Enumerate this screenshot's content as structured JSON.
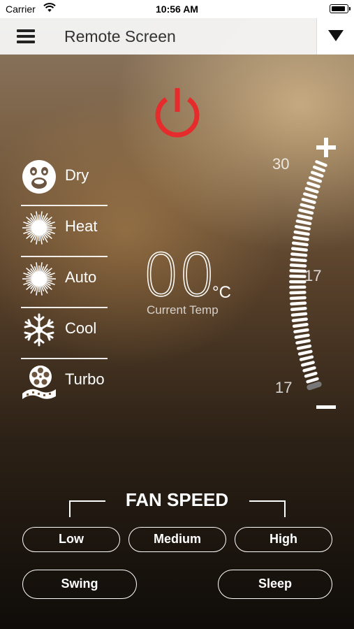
{
  "status_bar": {
    "carrier": "Carrier",
    "time": "10:56 AM"
  },
  "nav": {
    "title": "Remote Screen",
    "menu_icon": "hamburger-icon",
    "dropdown_icon": "triangle-down-icon"
  },
  "power": {
    "icon": "power-icon",
    "color": "#e52b2b"
  },
  "modes": [
    {
      "label": "Dry",
      "icon": "smiley-face-icon"
    },
    {
      "label": "Heat",
      "icon": "sun-burst-icon"
    },
    {
      "label": "Auto",
      "icon": "sun-burst-icon"
    },
    {
      "label": "Cool",
      "icon": "snowflake-icon"
    },
    {
      "label": "Turbo",
      "icon": "film-reel-icon"
    }
  ],
  "temperature": {
    "value": "00",
    "unit": "°C",
    "caption": "Current Temp"
  },
  "dial": {
    "max_label": "30",
    "mid_label": "17",
    "min_label": "17",
    "plus": "+",
    "minus": "−"
  },
  "fan_speed": {
    "title": "FAN SPEED",
    "low": "Low",
    "medium": "Medium",
    "high": "High"
  },
  "controls": {
    "swing": "Swing",
    "sleep": "Sleep"
  }
}
